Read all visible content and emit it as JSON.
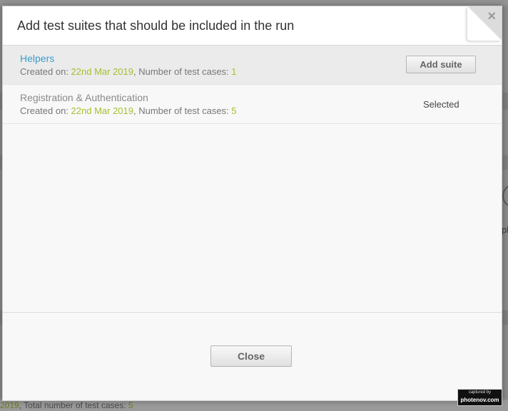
{
  "modal": {
    "title": "Add test suites that should be included in the run",
    "close_glyph": "×",
    "suites": [
      {
        "name": "Helpers",
        "created_label": "Created on: ",
        "created_date": "22nd Mar 2019",
        "cases_label": ", Number of test cases: ",
        "cases_count": "1",
        "action_label": "Add suite",
        "state": "available"
      },
      {
        "name": "Registration & Authentication",
        "created_label": "Created on: ",
        "created_date": "22nd Mar 2019",
        "cases_label": ", Number of test cases: ",
        "cases_count": "5",
        "action_label": "Selected",
        "state": "selected"
      }
    ],
    "close_button_label": "Close"
  },
  "background": {
    "footer_date_fragment": "2019",
    "footer_total_label": ", Total number of test cases: ",
    "footer_total_count": "5",
    "right_text_fragment": "pl"
  },
  "watermark": {
    "top": "captured by",
    "bottom": "photenov.com"
  },
  "colors": {
    "link": "#3b9dcd",
    "highlight": "#a3c12f",
    "overlay": "#8a8a8a"
  },
  "icons": {
    "close": "close-icon"
  }
}
